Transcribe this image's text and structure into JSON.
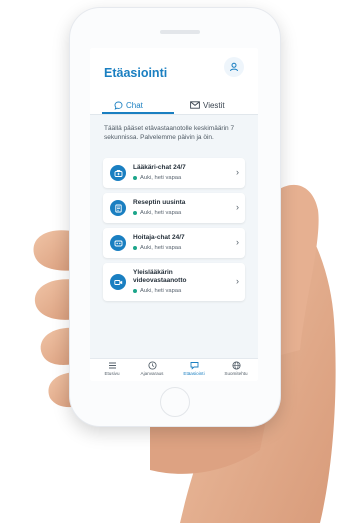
{
  "app": {
    "title": "Etäasiointi"
  },
  "tabs": [
    {
      "label": "Chat",
      "icon": "chat-bubble-icon",
      "active": true
    },
    {
      "label": "Viestit",
      "icon": "envelope-icon",
      "active": false
    }
  ],
  "intro": "Täällä pääset etävastaanotolle keskimäärin 7 sekunnissa. Palvelemme päivin ja öin.",
  "services": [
    {
      "title": "Lääkäri-chat 24/7",
      "status": "Auki, heti vapaa",
      "icon": "doctor-bag-icon"
    },
    {
      "title": "Reseptin uusinta",
      "status": "Auki, heti vapaa",
      "icon": "prescription-icon"
    },
    {
      "title": "Hoitaja-chat 24/7",
      "status": "Auki, heti vapaa",
      "icon": "nurse-icon"
    },
    {
      "title": "Yleislääkärin videovastaanotto",
      "status": "Auki, heti vapaa",
      "icon": "video-camera-icon"
    }
  ],
  "bottom_nav": [
    {
      "label": "Etusivu",
      "icon": "home-list-icon",
      "active": false
    },
    {
      "label": "Ajanvaraus",
      "icon": "clock-icon",
      "active": false
    },
    {
      "label": "Etäasiointi",
      "icon": "chat-icon",
      "active": true
    },
    {
      "label": "Suomitehtu",
      "icon": "globe-icon",
      "active": false
    }
  ],
  "colors": {
    "accent": "#1a7fc1",
    "status_open": "#1ca58a",
    "screen_bg": "#f2f6f9"
  }
}
